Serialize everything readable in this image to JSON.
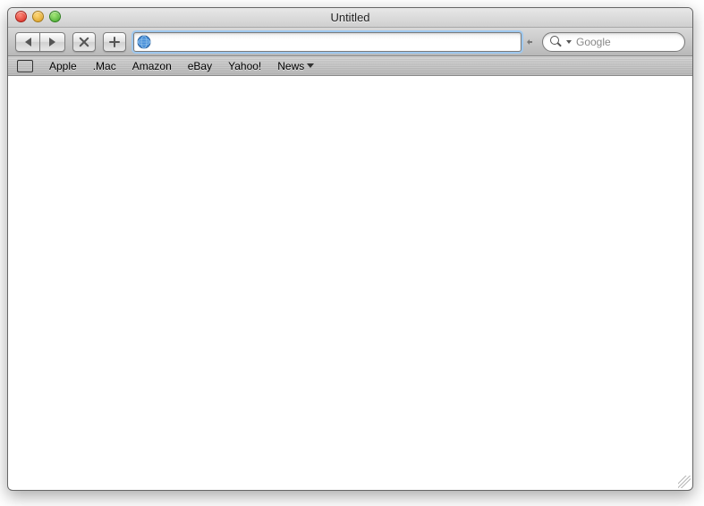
{
  "window": {
    "title": "Untitled"
  },
  "address_bar": {
    "value": ""
  },
  "search": {
    "placeholder": "Google",
    "value": ""
  },
  "bookmarks": {
    "items": [
      {
        "label": "Apple"
      },
      {
        "label": ".Mac"
      },
      {
        "label": "Amazon"
      },
      {
        "label": "eBay"
      },
      {
        "label": "Yahoo!"
      }
    ],
    "news_label": "News"
  }
}
